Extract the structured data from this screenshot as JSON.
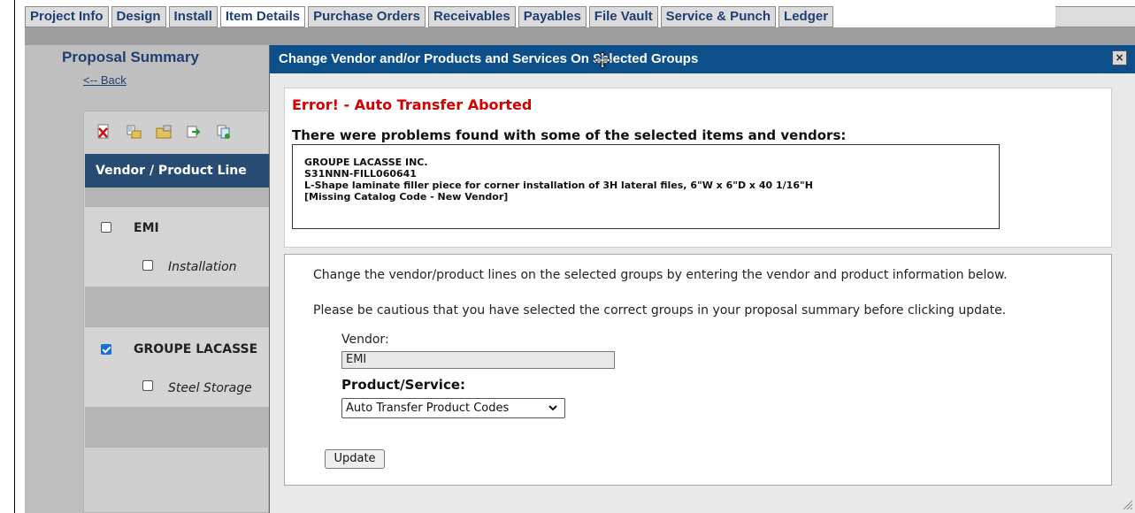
{
  "tabs": [
    {
      "label": "Project Info",
      "active": false
    },
    {
      "label": "Design",
      "active": false
    },
    {
      "label": "Install",
      "active": false
    },
    {
      "label": "Item Details",
      "active": true
    },
    {
      "label": "Purchase Orders",
      "active": false
    },
    {
      "label": "Receivables",
      "active": false
    },
    {
      "label": "Payables",
      "active": false
    },
    {
      "label": "File Vault",
      "active": false
    },
    {
      "label": "Service & Punch",
      "active": false
    },
    {
      "label": "Ledger",
      "active": false
    }
  ],
  "summary": {
    "title": "Proposal Summary",
    "back_link": "<-- Back",
    "toolbar_icons": [
      "delete-doc-icon",
      "new-folder-doc-icon",
      "open-folder-icon",
      "export-arrow-icon",
      "copy-doc-icon"
    ],
    "column_header": "Vendor / Product Line",
    "groups": [
      {
        "vendor": "EMI",
        "checked": false,
        "product": "Installation",
        "product_checked": false
      },
      {
        "vendor": "GROUPE LACASSE",
        "checked": true,
        "product": "Steel Storage",
        "product_checked": false
      }
    ]
  },
  "modal": {
    "title": "Change Vendor and/or Products and Services On Selected Groups",
    "close_label": "×",
    "error_title": "Error! - Auto Transfer Aborted",
    "error_subtitle": "There were problems found with some of the selected items and vendors:",
    "error_lines": [
      "GROUPE LACASSE INC.",
      "S31NNN-FILL060641",
      "L-Shape laminate filler piece for corner installation of 3H lateral files, 6\"W x 6\"D x 40 1/16\"H",
      "[Missing Catalog Code - New Vendor]"
    ],
    "instruction_1": "Change the vendor/product lines on the selected groups by entering the vendor and product information below.",
    "instruction_2": "Please be cautious that you have selected the correct groups in your proposal summary before clicking update.",
    "vendor_label": "Vendor:",
    "vendor_value": "EMI",
    "product_label": "Product/Service:",
    "product_selected": "Auto Transfer Product Codes",
    "update_label": "Update"
  },
  "colors": {
    "tab_text": "#1f3f74",
    "modal_titlebar": "#0d4f8b",
    "error_red": "#d40000",
    "table_header": "#274b73",
    "checkbox_checked": "#1a6fd1"
  }
}
